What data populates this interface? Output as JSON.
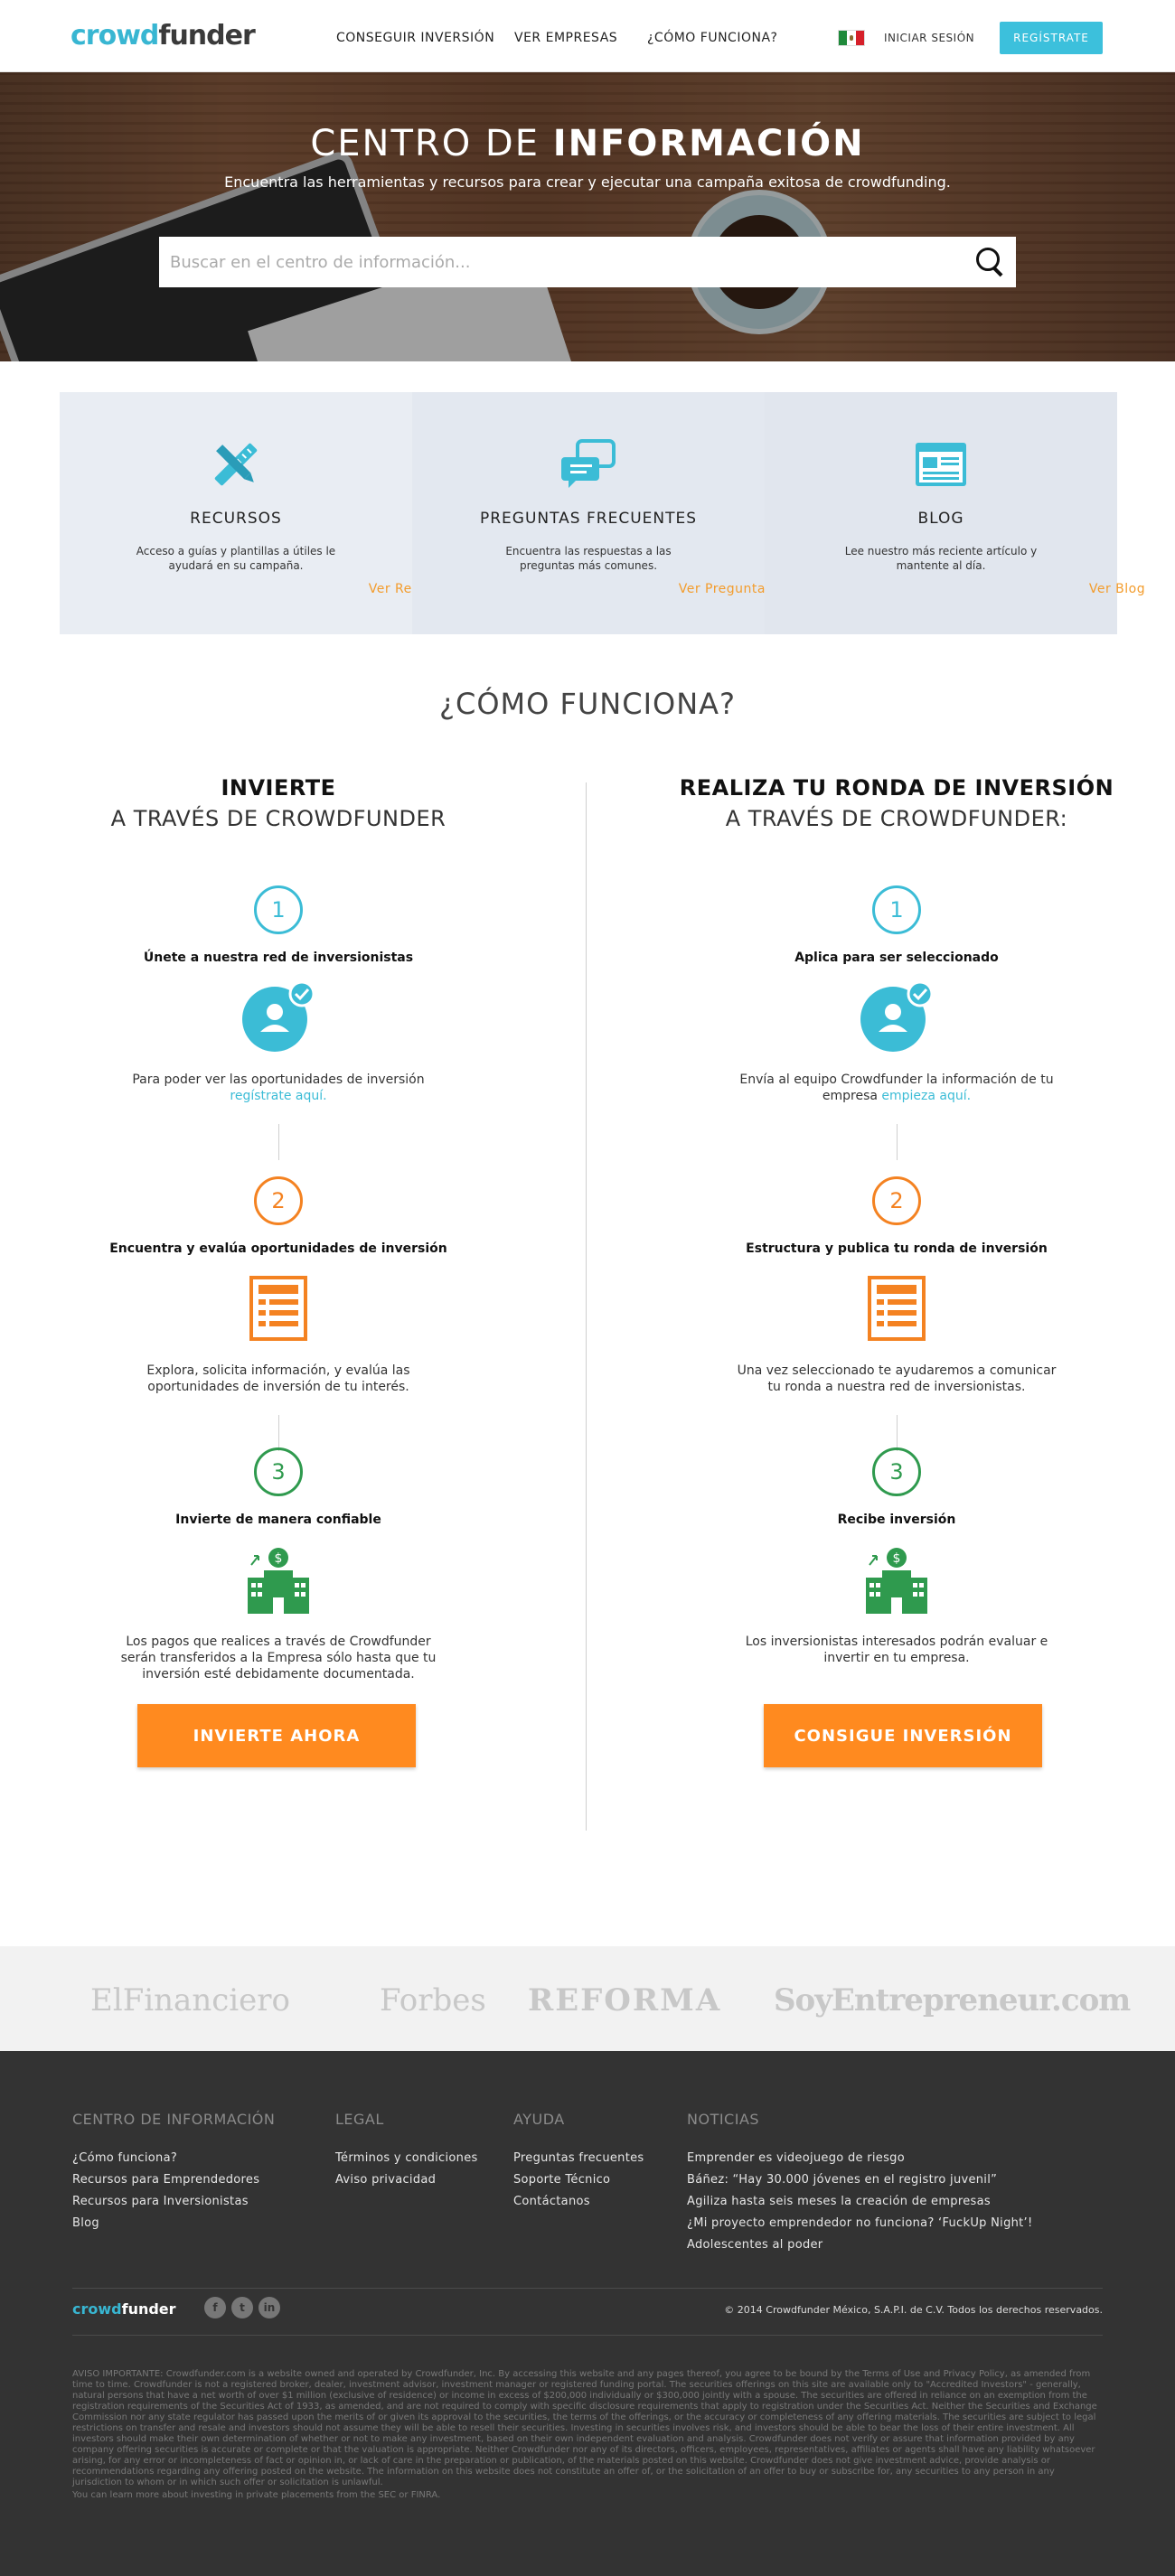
{
  "header": {
    "logo_a": "crowd",
    "logo_b": "funder",
    "nav": [
      "CONSEGUIR INVERSIÓN",
      "VER EMPRESAS",
      "¿CÓMO FUNCIONA?"
    ],
    "login": "INICIAR SESIÓN",
    "register": "REGÍSTRATE"
  },
  "hero": {
    "title_a": "CENTRO DE ",
    "title_b": "INFORMACIÓN",
    "subtitle": "Encuentra las herramientas y recursos para crear y ejecutar una campaña exitosa de crowdfunding.",
    "search_placeholder": "Buscar en el centro de información..."
  },
  "cards": [
    {
      "title": "RECURSOS",
      "text": "Acceso a guías y plantillas a útiles le ayudará en su campaña.",
      "link": "Ver Recursos",
      "icon": "tools-icon"
    },
    {
      "title": "PREGUNTAS FRECUENTES",
      "text": "Encuentra las respuestas a las preguntas más comunes.",
      "link": "Ver Preguntas Frecuentes",
      "icon": "chat-bubbles-icon"
    },
    {
      "title": "BLOG",
      "text": "Lee nuestro más reciente artículo y mantente al día.",
      "link": "Ver Blog",
      "icon": "browser-window-icon"
    }
  ],
  "how": {
    "title": "¿CÓMO FUNCIONA?",
    "left": {
      "heading": "INVIERTE",
      "subheading": "A TRAVÉS DE CROWDFUNDER",
      "steps": [
        {
          "num": "1",
          "title": "Únete a nuestra red de inversionistas",
          "text": "Para poder ver las oportunidades de inversión",
          "link": "regístrate aquí."
        },
        {
          "num": "2",
          "title": "Encuentra y evalúa oportunidades de inversión",
          "text": "Explora, solicita información, y evalúa las oportunidades de inversión de tu interés."
        },
        {
          "num": "3",
          "title": "Invierte de manera confiable",
          "text": "Los pagos que realices a través de Crowdfunder serán transferidos a la Empresa sólo hasta que tu inversión esté debidamente documentada."
        }
      ],
      "cta": "INVIERTE AHORA"
    },
    "right": {
      "heading": "REALIZA TU RONDA DE INVERSIÓN",
      "subheading": "A TRAVÉS DE CROWDFUNDER:",
      "steps": [
        {
          "num": "1",
          "title": "Aplica para ser seleccionado",
          "text": "Envía al equipo Crowdfunder la información de tu empresa",
          "link": "empieza aquí."
        },
        {
          "num": "2",
          "title": "Estructura y publica tu ronda de inversión",
          "text": "Una vez seleccionado te ayudaremos a comunicar tu ronda a nuestra red de inversionistas."
        },
        {
          "num": "3",
          "title": "Recibe inversión",
          "text": "Los inversionistas interesados podrán evaluar e invertir en tu empresa."
        }
      ],
      "cta": "CONSIGUE INVERSIÓN"
    }
  },
  "press": [
    "ElFinanciero",
    "Forbes",
    "REFORMA",
    "SoyEntrepreneur.com"
  ],
  "footer": {
    "cols": [
      {
        "title": "CENTRO DE INFORMACIÓN",
        "items": [
          "¿Cómo funciona?",
          "Recursos para Emprendedores",
          "Recursos para Inversionistas",
          "Blog"
        ]
      },
      {
        "title": "LEGAL",
        "items": [
          "Términos y condiciones",
          "Aviso privacidad"
        ]
      },
      {
        "title": "AYUDA",
        "items": [
          "Preguntas frecuentes",
          "Soporte Técnico",
          "Contáctanos"
        ]
      },
      {
        "title": "NOTICIAS",
        "items": [
          "Emprender es videojuego de riesgo",
          "Báñez: “Hay 30.000 jóvenes en el registro juvenil”",
          "Agiliza hasta seis meses la creación de empresas",
          "¿Mi proyecto emprendedor no funciona? ‘FuckUp Night’!",
          "Adolescentes al poder"
        ]
      }
    ],
    "logo_a": "crowd",
    "logo_b": "funder",
    "social": [
      "f",
      "t",
      "in"
    ],
    "copyright": "© 2014 Crowdfunder México, S.A.P.I. de C.V. Todos los derechos reservados.",
    "legal": "AVISO IMPORTANTE: Crowdfunder.com is a website owned and operated by Crowdfunder, Inc. By accessing this website and any pages thereof, you agree to be bound by the Terms of Use and Privacy Policy, as amended from time to time. Crowdfunder is not a registered broker, dealer, investment advisor, investment manager or registered funding portal. The securities offerings on this site are available only to \"Accredited Investors\" - generally, natural persons that have a net worth of over $1 million (exclusive of residence) or income in excess of $200,000 individually or $300,000 jointly with a spouse. The securities are offered in reliance on an exemption from the registration requirements of the Securities Act of 1933, as amended, and are not required to comply with specific disclosure requirements that apply to registration under the Securities Act. Neither the Securities and Exchange Commission nor any state regulator has passed upon the merits of or given its approval to the securities, the terms of the offerings, or the accuracy or completeness of any offering materials. The securities are subject to legal restrictions on transfer and resale and investors should not assume they will be able to resell their securities. Investing in securities involves risk, and investors should be able to bear the loss of their entire investment. All investors should make their own determination of whether or not to make any investment, based on their own independent evaluation and analysis. Crowdfunder does not verify or assure that information provided by any company offering securities is accurate or complete or that the valuation is appropriate. Neither Crowdfunder nor any of its directors, officers, employees, representatives, affiliates or agents shall have any liability whatsoever arising, for any error or incompleteness of fact or opinion in, or lack of care in the preparation or publication, of the materials posted on this website. Crowdfunder does not give investment advice, provide analysis or recommendations regarding any offering posted on the website. The information on this website does not constitute an offer of, or the solicitation of an offer to buy or subscribe for, any securities to any person in any jurisdiction to whom or in which such offer or solicitation is unlawful.",
    "legal2": "You can learn more about investing in private placements from the SEC or FINRA."
  }
}
